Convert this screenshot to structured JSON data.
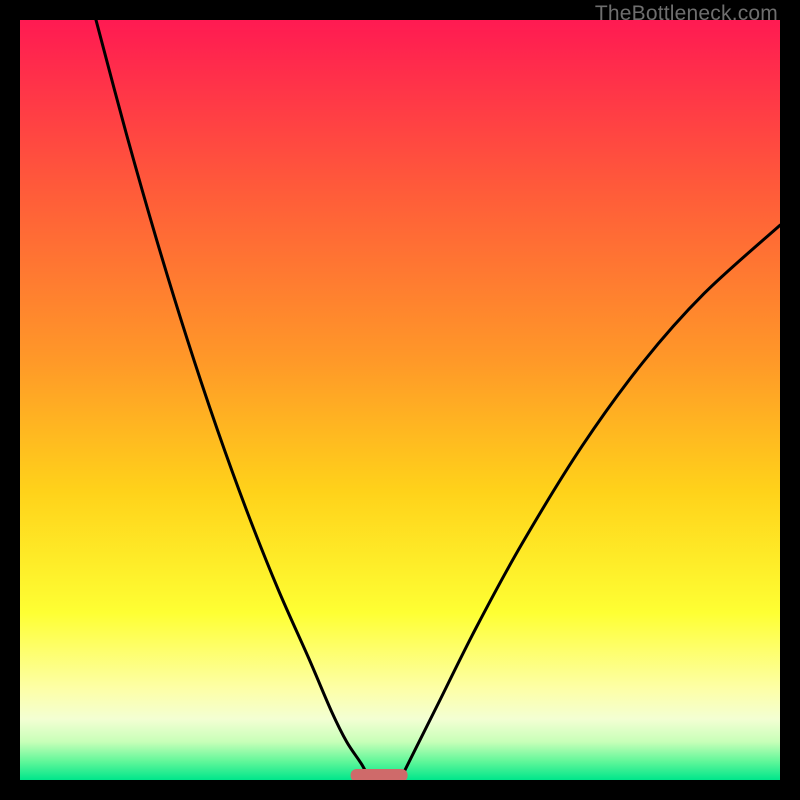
{
  "watermark": "TheBottleneck.com",
  "chart_data": {
    "type": "line",
    "title": "",
    "xlabel": "",
    "ylabel": "",
    "xlim": [
      0,
      100
    ],
    "ylim": [
      0,
      100
    ],
    "grid": false,
    "legend": false,
    "series": [
      {
        "name": "left-branch",
        "x": [
          10,
          14,
          18,
          22,
          26,
          30,
          34,
          38,
          41,
          43,
          45,
          46
        ],
        "values": [
          100,
          85,
          71,
          58,
          46,
          35,
          25,
          16,
          9,
          5,
          2,
          0
        ]
      },
      {
        "name": "right-branch",
        "x": [
          50,
          52,
          55,
          60,
          66,
          74,
          82,
          90,
          100
        ],
        "values": [
          0,
          4,
          10,
          20,
          31,
          44,
          55,
          64,
          73
        ]
      }
    ],
    "marker": {
      "name": "optimum-bar",
      "x_range": [
        43.5,
        51
      ],
      "y": 0,
      "color": "#cf6a6a"
    },
    "background_gradient": {
      "stops": [
        {
          "pos": 0.0,
          "color": "#ff1a52"
        },
        {
          "pos": 0.22,
          "color": "#ff5a3a"
        },
        {
          "pos": 0.45,
          "color": "#ff9928"
        },
        {
          "pos": 0.62,
          "color": "#ffd21a"
        },
        {
          "pos": 0.78,
          "color": "#feff33"
        },
        {
          "pos": 0.88,
          "color": "#fdffa7"
        },
        {
          "pos": 0.92,
          "color": "#f3ffd3"
        },
        {
          "pos": 0.95,
          "color": "#c7ffb8"
        },
        {
          "pos": 0.975,
          "color": "#63f79a"
        },
        {
          "pos": 1.0,
          "color": "#00e68b"
        }
      ]
    }
  }
}
